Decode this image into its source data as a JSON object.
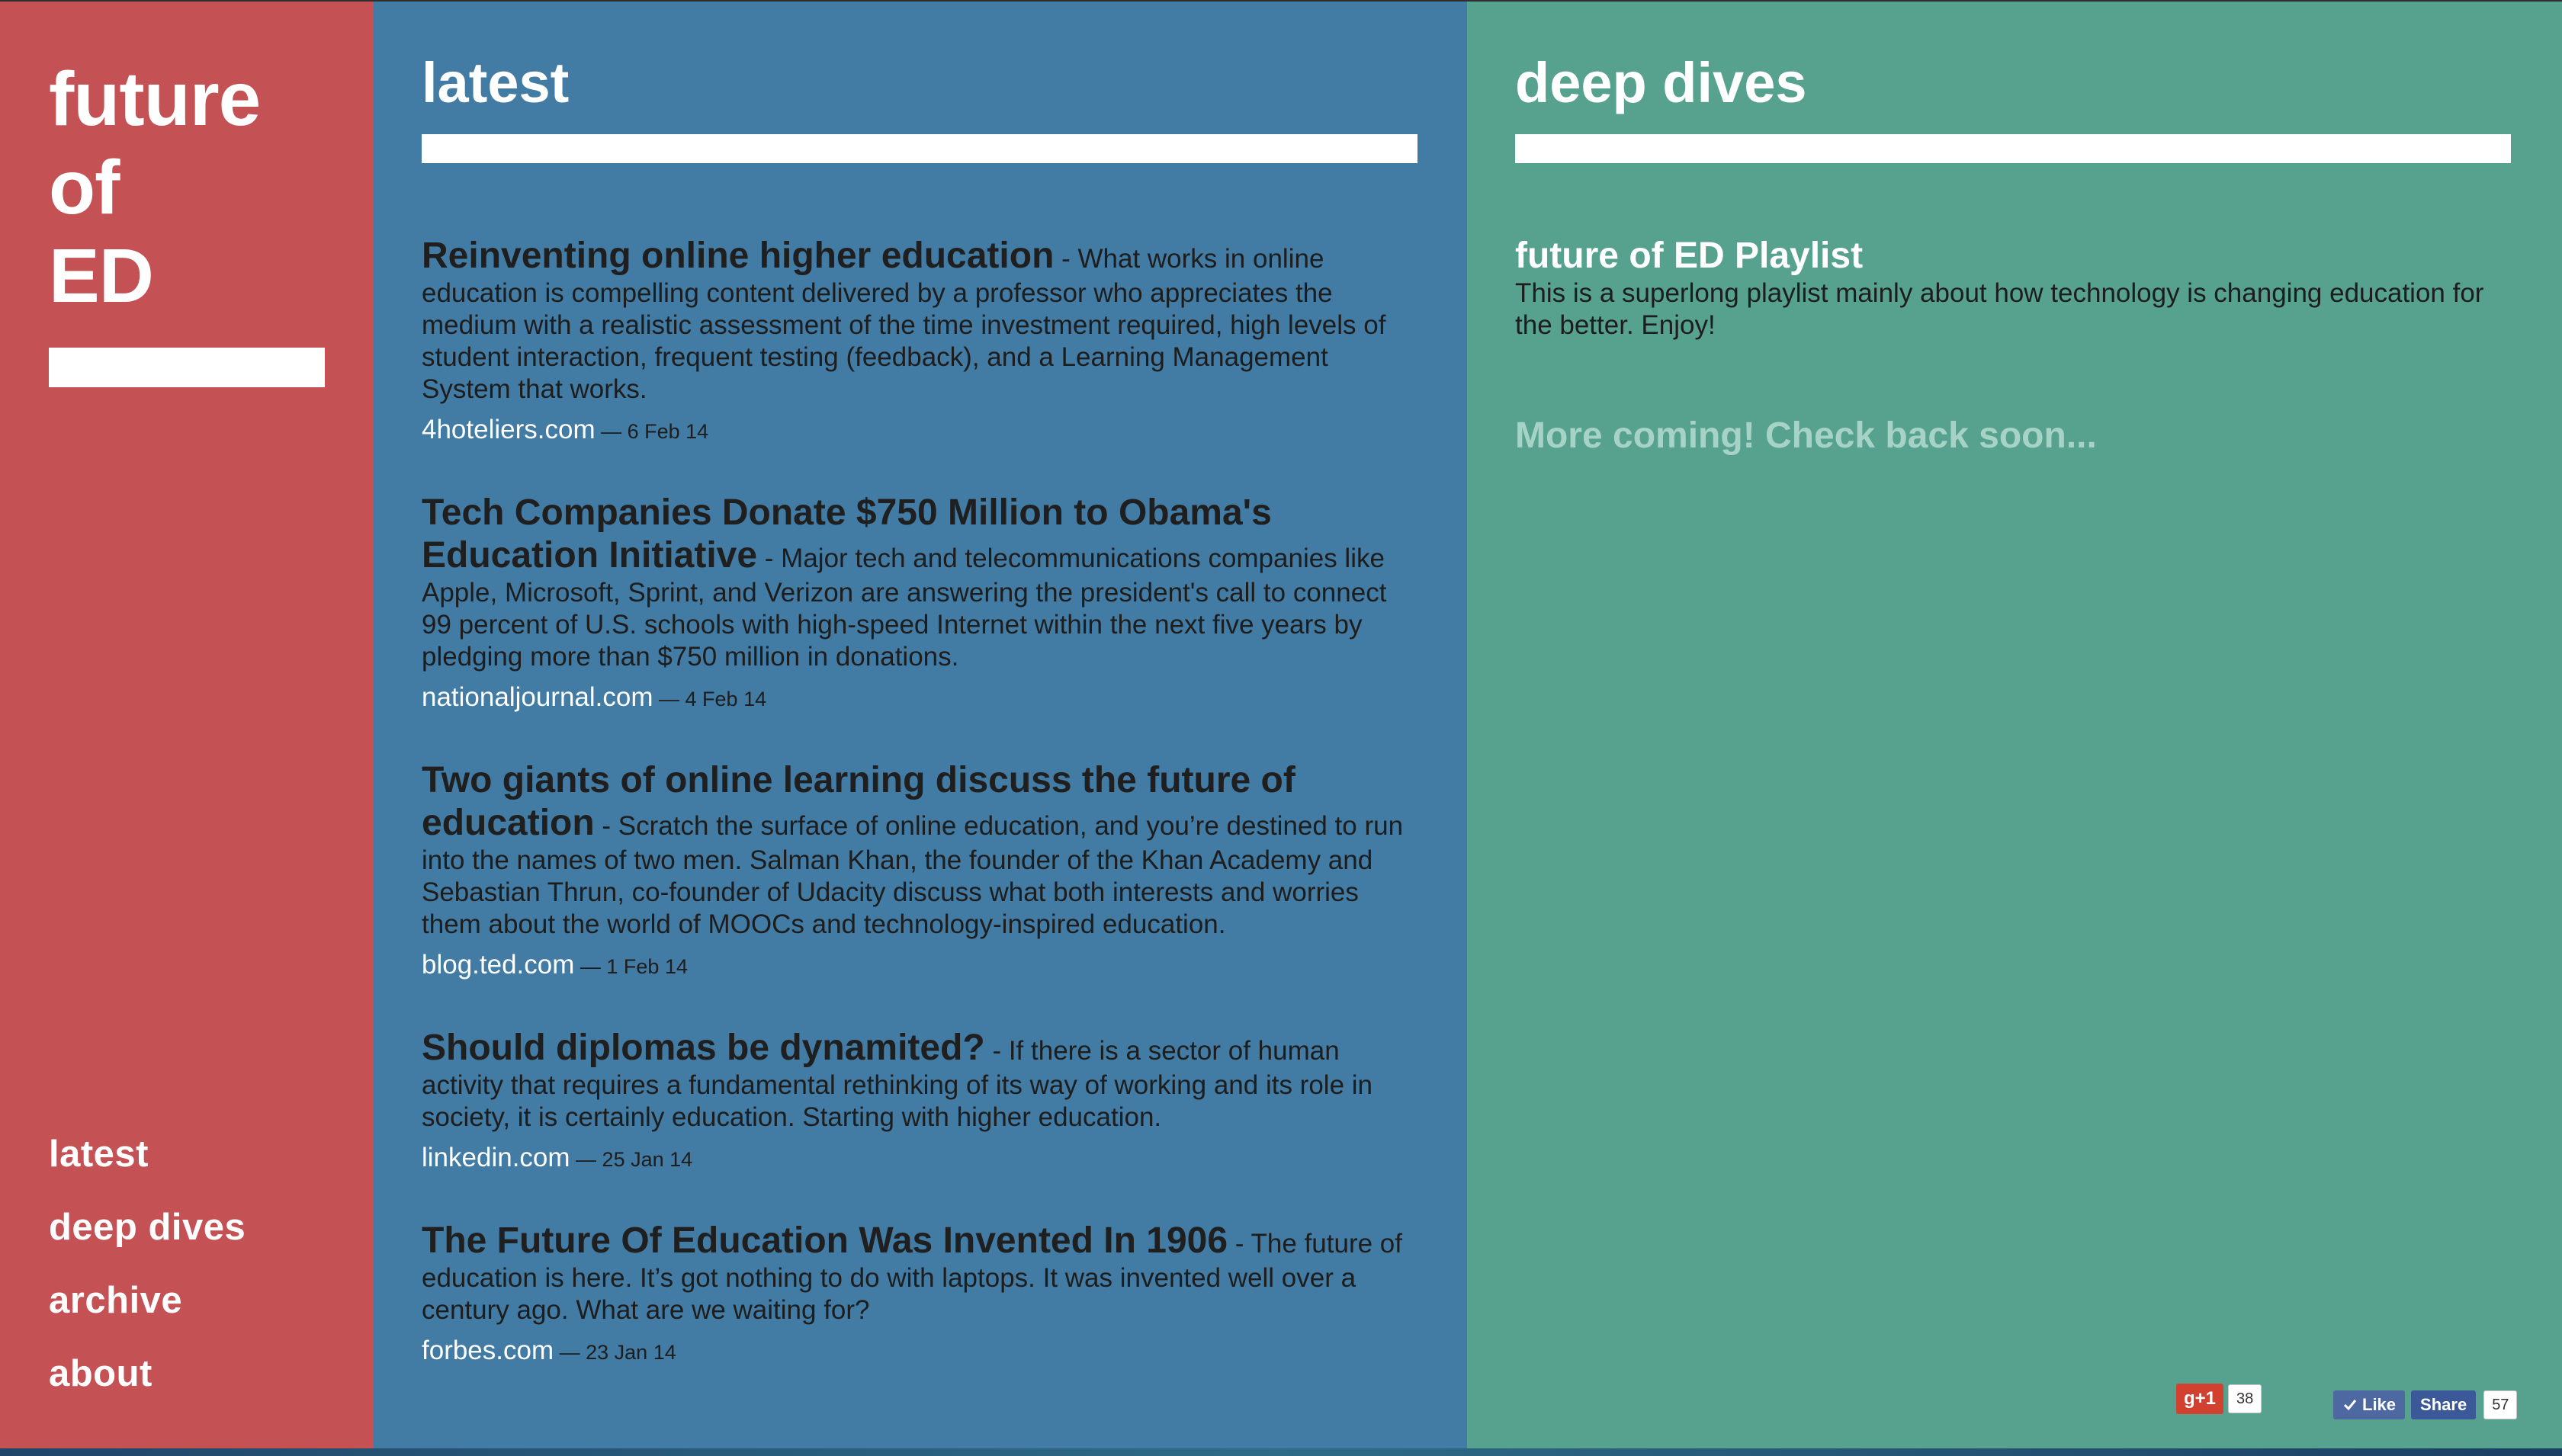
{
  "sidebar": {
    "logo": [
      "future",
      "of",
      "ED"
    ],
    "nav": [
      {
        "label": "latest"
      },
      {
        "label": "deep dives"
      },
      {
        "label": "archive"
      },
      {
        "label": "about"
      }
    ]
  },
  "latest": {
    "title": "latest",
    "articles": [
      {
        "title": "Reinventing online higher education",
        "description": " - What works in online education is compelling content delivered by a professor who appreciates the medium with a realistic assessment of the time investment required, high levels of student interaction, frequent testing (feedback), and a Learning Management System that works.",
        "source": "4hoteliers.com",
        "date": " — 6 Feb 14"
      },
      {
        "title": "Tech Companies Donate $750 Million to Obama's Education Initiative",
        "description": " - Major tech and telecommunications companies like Apple, Microsoft, Sprint, and Verizon are answering the president's call to connect 99 percent of U.S. schools with high-speed Internet within the next five years by pledging more than $750 million in donations.",
        "source": "nationaljournal.com",
        "date": " — 4 Feb 14"
      },
      {
        "title": "Two giants of online learning discuss the future of education",
        "description": " - Scratch the surface of online education, and you’re destined to run into the names of two men. Salman Khan, the founder of the Khan Academy and Sebastian Thrun, co-founder of Udacity discuss what both interests and worries them about the world of MOOCs and technology-inspired education.",
        "source": "blog.ted.com",
        "date": " — 1 Feb 14"
      },
      {
        "title": "Should diplomas be dynamited?",
        "description": " - If there is a sector of human activity that requires a fundamental rethinking of its way of working and its role in society, it is certainly education. Starting with higher education.",
        "source": "linkedin.com",
        "date": " — 25 Jan 14"
      },
      {
        "title": "The Future Of Education Was Invented In 1906",
        "description": " - The future of education is here. It’s got nothing to do with laptops. It was invented well over a century ago. What are we waiting for?",
        "source": "forbes.com",
        "date": " — 23 Jan 14"
      }
    ]
  },
  "deep_dives": {
    "title": "deep dives",
    "playlist_title": "future of ED Playlist",
    "playlist_description": "This is a superlong playlist mainly about how technology is changing education for the better. Enjoy!",
    "more_coming": "More coming! Check back soon..."
  },
  "social": {
    "gplus_label": "g+1",
    "gplus_count": "38",
    "fb_like_label": "Like",
    "fb_share_label": "Share",
    "fb_count": "57"
  },
  "colors": {
    "sidebar": "#c45154",
    "latest": "#427ba3",
    "deep_dives": "#57a28f"
  }
}
